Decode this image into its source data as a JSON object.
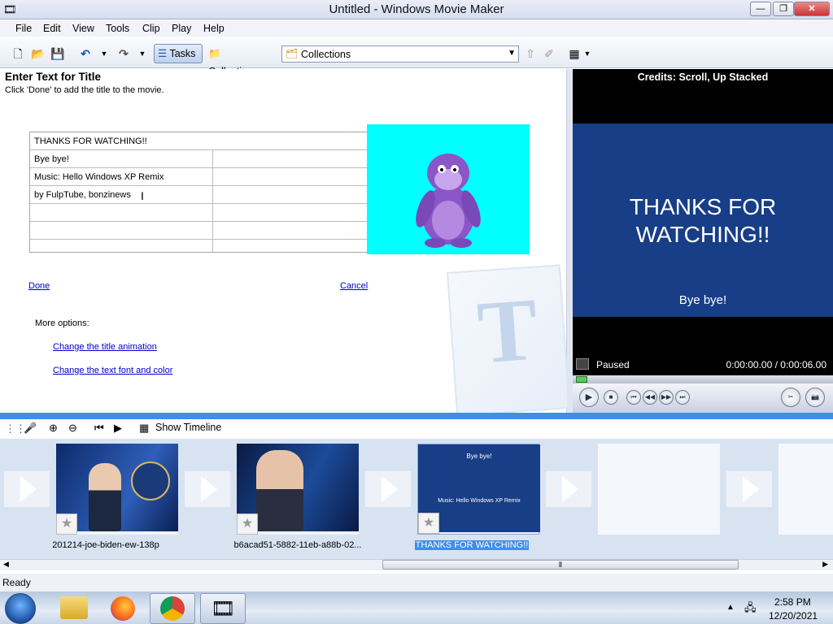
{
  "window": {
    "title": "Untitled - Windows Movie Maker"
  },
  "menu": [
    "File",
    "Edit",
    "View",
    "Tools",
    "Clip",
    "Play",
    "Help"
  ],
  "toolbar": {
    "tasks_label": "Tasks",
    "collections_label": "Collections",
    "collections_select": "Collections"
  },
  "task": {
    "heading": "Enter Text for Title",
    "subheading": "Click 'Done' to add the title to the movie.",
    "title_lines": [
      "THANKS FOR WATCHING!!",
      "Bye bye!",
      "Music: Hello Windows XP Remix",
      "by FulpTube, bonzinews",
      "",
      "",
      ""
    ],
    "done_label": "Done",
    "cancel_label": "Cancel",
    "more_options": "More options:",
    "change_animation": "Change the title animation",
    "change_font": "Change the text font and color"
  },
  "preview": {
    "title": "Credits: Scroll, Up Stacked",
    "main_text": "THANKS FOR WATCHING!!",
    "sub_text": "Bye bye!",
    "status": "Paused",
    "time": "0:00:00.00 / 0:00:06.00"
  },
  "storyboard": {
    "show_timeline": "Show Timeline",
    "clips": [
      {
        "label": "201214-joe-biden-ew-138p"
      },
      {
        "label": "b6acad51-5882-11eb-a88b-02..."
      },
      {
        "label": "THANKS FOR WATCHING!!",
        "thumb_top": "Bye bye!",
        "thumb_bottom": "Music: Hello Windows XP Remix"
      }
    ]
  },
  "status": {
    "text": "Ready"
  },
  "clock": {
    "time": "2:58 PM",
    "date": "12/20/2021"
  },
  "colors": {
    "accent": "#3f8ee8",
    "preview_bg": "#173e86",
    "bonzi_bg": "#00ffff",
    "link": "#0000cc"
  }
}
